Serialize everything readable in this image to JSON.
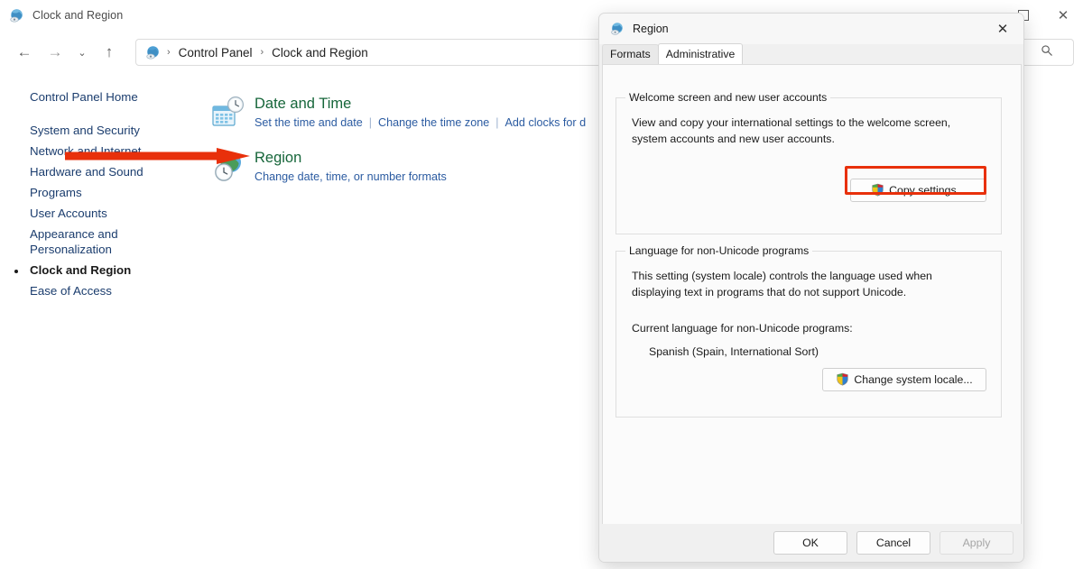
{
  "window": {
    "title": "Clock and Region",
    "icon": "control-panel-icon",
    "controls": {
      "minimize": "–",
      "maximize": "□",
      "close": "✕"
    }
  },
  "navbar": {
    "back": "←",
    "forward": "→",
    "recent": "⌄",
    "up": "↑",
    "breadcrumb": {
      "icon": "control-panel-icon",
      "items": [
        "Control Panel",
        "Clock and Region"
      ],
      "separator": "›"
    },
    "search_icon": "search-icon"
  },
  "sidebar": {
    "home": "Control Panel Home",
    "items": [
      {
        "label": "System and Security",
        "current": false
      },
      {
        "label": "Network and Internet",
        "current": false
      },
      {
        "label": "Hardware and Sound",
        "current": false
      },
      {
        "label": "Programs",
        "current": false
      },
      {
        "label": "User Accounts",
        "current": false
      },
      {
        "label": "Appearance and\nPersonalization",
        "current": false
      },
      {
        "label": "Clock and Region",
        "current": true
      },
      {
        "label": "Ease of Access",
        "current": false
      }
    ]
  },
  "main": {
    "categories": [
      {
        "title": "Date and Time",
        "icon": "calendar-clock-icon",
        "links": [
          "Set the time and date",
          "Change the time zone",
          "Add clocks for d"
        ]
      },
      {
        "title": "Region",
        "icon": "globe-clock-icon",
        "links": [
          "Change date, time, or number formats"
        ]
      }
    ],
    "annotation": {
      "type": "red-arrow",
      "color": "#e8300b",
      "points_to": "Region"
    }
  },
  "dialog": {
    "title": "Region",
    "icon": "region-globe-icon",
    "close_label": "✕",
    "tabs": [
      {
        "label": "Formats",
        "active": false
      },
      {
        "label": "Administrative",
        "active": true
      }
    ],
    "group_welcome": {
      "title": "Welcome screen and new user accounts",
      "description": "View and copy your international settings to the welcome screen, system accounts and new user accounts.",
      "button": {
        "label": "Copy settings...",
        "icon": "uac-shield-icon",
        "highlighted": true,
        "highlight_color": "#e8300b"
      }
    },
    "group_language": {
      "title": "Language for non-Unicode programs",
      "description": "This setting (system locale) controls the language used when displaying text in programs that do not support Unicode.",
      "current_label": "Current language for non-Unicode programs:",
      "current_value": "Spanish (Spain, International Sort)",
      "button": {
        "label": "Change system locale...",
        "icon": "uac-shield-icon"
      }
    },
    "footer": {
      "ok": "OK",
      "cancel": "Cancel",
      "apply": "Apply",
      "apply_disabled": true
    }
  },
  "colors": {
    "link": "#2b5ba1",
    "category_title": "#16663a",
    "sidebar_link": "#1b3d6e",
    "annotation_red": "#e8300b"
  }
}
